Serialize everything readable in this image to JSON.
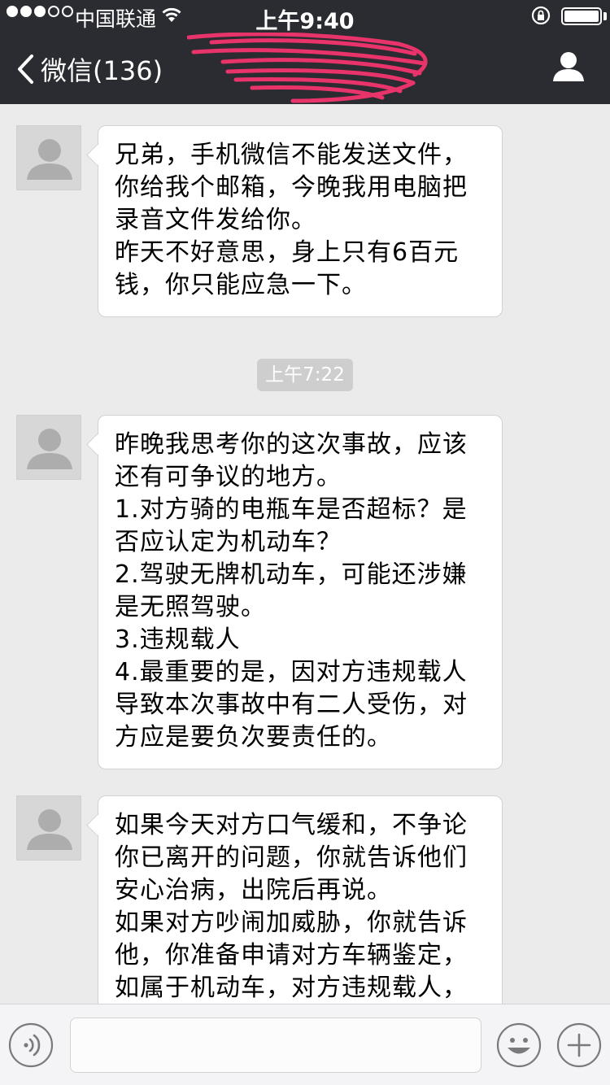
{
  "status_bar": {
    "carrier": "中国联通",
    "time": "上午9:40",
    "signal_bars_filled": 3,
    "signal_bars_total": 5,
    "battery_level": 1.0
  },
  "nav": {
    "back_label": "微信(136)",
    "title_redacted": true
  },
  "messages": [
    {
      "type": "incoming",
      "text": "兄弟，手机微信不能发送文件，你给我个邮箱，今晚我用电脑把录音文件发给你。\n昨天不好意思，身上只有6百元钱，你只能应急一下。"
    },
    {
      "type": "timestamp",
      "text": "上午7:22"
    },
    {
      "type": "incoming",
      "text": "昨晚我思考你的这次事故，应该还有可争议的地方。\n1.对方骑的电瓶车是否超标？是否应认定为机动车？\n2.驾驶无牌机动车，可能还涉嫌是无照驾驶。\n3.违规载人\n4.最重要的是，因对方违规载人导致本次事故中有二人受伤，对方应是要负次要责任的。"
    },
    {
      "type": "incoming",
      "text": "如果今天对方口气缓和，不争论你已离开的问题，你就告诉他们安心治病，出院后再说。\n如果对方吵闹加威胁，你就告诉他，你准备申请对方车辆鉴定，如属于机动车，对方违规载人，"
    }
  ],
  "colors": {
    "nav_bg": "#2b2c31",
    "chat_bg": "#ebebeb",
    "bubble_bg": "#ffffff",
    "redaction": "#e8336b"
  },
  "icons": {
    "back": "chevron-left-icon",
    "profile": "person-icon",
    "voice": "voice-icon",
    "emoji": "smiley-icon",
    "plus": "plus-icon",
    "wifi": "wifi-icon",
    "rotation_lock": "rotation-lock-icon",
    "avatar": "default-avatar-icon"
  }
}
